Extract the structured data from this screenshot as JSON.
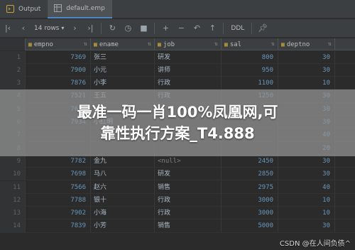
{
  "tabs": [
    {
      "label": "Output",
      "icon": "output-icon"
    },
    {
      "label": "default.emp",
      "icon": "table-icon"
    }
  ],
  "toolbar": {
    "rows_label": "14 rows",
    "ddl_label": "DDL"
  },
  "columns": [
    {
      "name": "empno",
      "type": "number"
    },
    {
      "name": "ename",
      "type": "text"
    },
    {
      "name": "job",
      "type": "text"
    },
    {
      "name": "sal",
      "type": "number"
    },
    {
      "name": "deptno",
      "type": "number"
    }
  ],
  "rows": [
    {
      "n": "1",
      "empno": "7369",
      "ename": "张三",
      "job": "研发",
      "sal": "800",
      "deptno": "30"
    },
    {
      "n": "2",
      "empno": "7900",
      "ename": "小元",
      "job": "讲师",
      "sal": "950",
      "deptno": "30"
    },
    {
      "n": "3",
      "empno": "7876",
      "ename": "小李",
      "job": "行政",
      "sal": "1100",
      "deptno": "10"
    },
    {
      "n": "4",
      "empno": "7521",
      "ename": "王五",
      "job": "行政",
      "sal": "1250",
      "deptno": "30"
    },
    {
      "n": "5",
      "empno": "7654",
      "ename": "",
      "job": "",
      "sal": "",
      "deptno": "30"
    },
    {
      "n": "6",
      "empno": "7934",
      "ename": "小红明",
      "job": "",
      "sal": "",
      "deptno": "30"
    },
    {
      "n": "7",
      "empno": "",
      "ename": "",
      "job": "",
      "sal": "",
      "deptno": "40"
    },
    {
      "n": "8",
      "empno": "",
      "ename": "",
      "job": "",
      "sal": "",
      "deptno": "20"
    },
    {
      "n": "9",
      "empno": "7782",
      "ename": "金九",
      "job": "<null>",
      "sal": "2450",
      "deptno": "30"
    },
    {
      "n": "10",
      "empno": "7698",
      "ename": "马八",
      "job": "研发",
      "sal": "2850",
      "deptno": "30"
    },
    {
      "n": "11",
      "empno": "7566",
      "ename": "赵六",
      "job": "销售",
      "sal": "2975",
      "deptno": "40"
    },
    {
      "n": "12",
      "empno": "7788",
      "ename": "银十",
      "job": "行政",
      "sal": "3000",
      "deptno": "10"
    },
    {
      "n": "13",
      "empno": "7902",
      "ename": "小海",
      "job": "行政",
      "sal": "3000",
      "deptno": "10"
    },
    {
      "n": "14",
      "empno": "7839",
      "ename": "小芳",
      "job": "销售",
      "sal": "5000",
      "deptno": "30"
    }
  ],
  "overlay": {
    "line1": "最准一码一肖100%凤凰网,可",
    "line2": "靠性执行方案_T4.888"
  },
  "watermark": "CSDN @在人间负债^"
}
